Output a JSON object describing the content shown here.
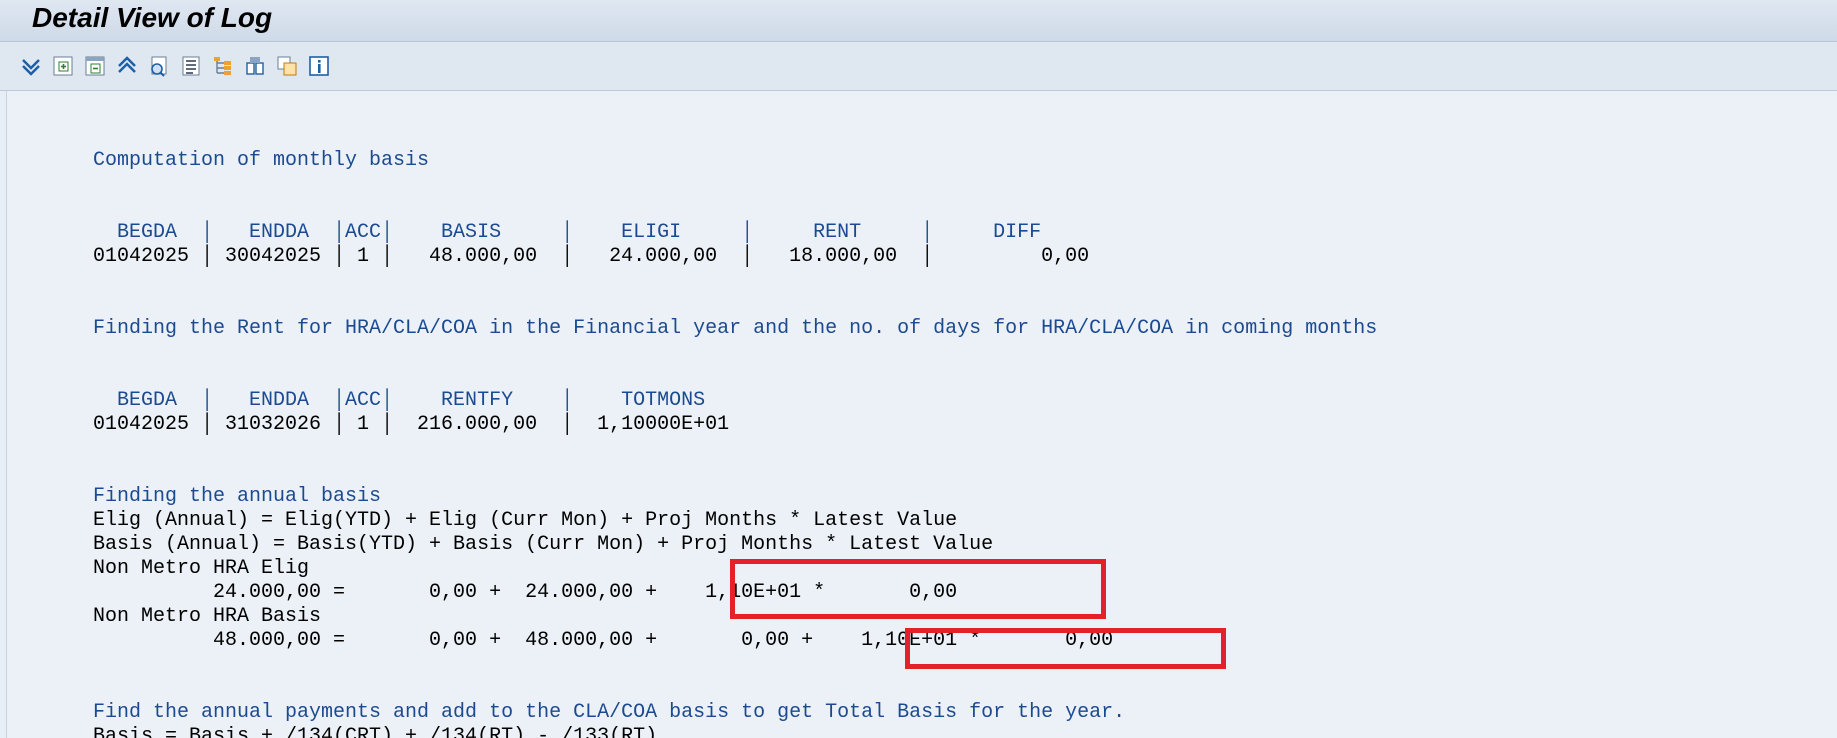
{
  "window": {
    "title": "Detail View of Log"
  },
  "toolbar": {
    "buttons": [
      {
        "icon": "expand-all-icon"
      },
      {
        "icon": "expand-subtree-icon"
      },
      {
        "icon": "collapse-subtree-icon"
      },
      {
        "icon": "collapse-all-icon"
      },
      {
        "icon": "find-icon"
      },
      {
        "icon": "list-icon"
      },
      {
        "icon": "hierarchy-icon"
      },
      {
        "icon": "navigate-icon"
      },
      {
        "icon": "copy-icon"
      },
      {
        "icon": "info-icon"
      }
    ]
  },
  "log": {
    "section1": {
      "title": "Computation of monthly basis",
      "header": "  BEGDA  │   ENDDA  │ACC│    BASIS     │    ELIGI     │     RENT     │     DIFF",
      "row": "01042025 │ 30042025 │ 1 │   48.000,00  │   24.000,00  │   18.000,00  │         0,00"
    },
    "section2": {
      "title": "Finding the Rent for HRA/CLA/COA in the Financial year and the no. of days for HRA/CLA/COA in coming months",
      "header": "  BEGDA  │   ENDDA  │ACC│    RENTFY    │    TOTMONS",
      "row": "01042025 │ 31032026 │ 1 │  216.000,00  │  1,10000E+01"
    },
    "section3": {
      "title": "Finding the annual basis",
      "formula_elig": "Elig (Annual) = Elig(YTD) + Elig (Curr Mon) + Proj Months * Latest Value",
      "formula_basis": "Basis (Annual) = Basis(YTD) + Basis (Curr Mon) + Proj Months * Latest Value",
      "elig_label": "Non Metro HRA Elig",
      "elig_row": "          24.000,00 =       0,00 +  24.000,00 +    1,10E+01 *       0,00",
      "basis_label": "Non Metro HRA Basis",
      "basis_row": "          48.000,00 =       0,00 +  48.000,00 +       0,00 +    1,10E+01 *       0,00"
    },
    "section4": {
      "title": "Find the annual payments and add to the CLA/COA basis to get Total Basis for the year.",
      "formula": "Basis = Basis + /134(CRT) + /134(RT) - /133(RT)"
    }
  },
  "colors": {
    "heading_blue": "#1c4a91",
    "highlight_red": "#e4212b"
  }
}
